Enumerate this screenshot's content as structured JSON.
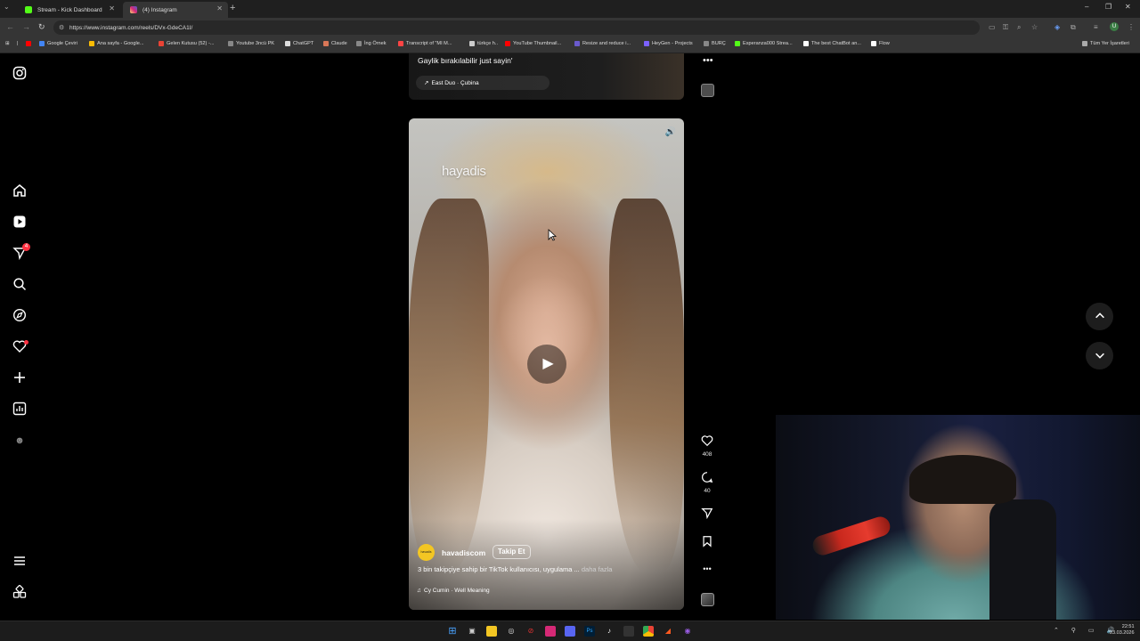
{
  "browser": {
    "tabs": [
      {
        "title": "Stream - Kick Dashboard",
        "color": "#53fc18"
      },
      {
        "title": "(4) Instagram",
        "color": "#e1306c"
      }
    ],
    "url": "https://www.instagram.com/reels/DVx-GdeCA1I/",
    "bookmarks": [
      {
        "label": "Google Çeviri",
        "color": "#4285f4"
      },
      {
        "label": "Ana sayfa - Google...",
        "color": "#fbbc05"
      },
      {
        "label": "Gelen Kutusu (52) -...",
        "color": "#ea4335"
      },
      {
        "label": "Youtube 3ncü PK",
        "color": "#888888"
      },
      {
        "label": "ChatGPT",
        "color": "#dddddd"
      },
      {
        "label": "Claude",
        "color": "#d97757"
      },
      {
        "label": "İng Örnek",
        "color": "#888888"
      },
      {
        "label": "Transcript of \"MI M...",
        "color": "#ff4444"
      },
      {
        "label": "türkçe h..",
        "color": "#cccccc"
      },
      {
        "label": "YouTube Thumbnail...",
        "color": "#ff0000"
      },
      {
        "label": "Resize and reduce i...",
        "color": "#6a5acd"
      },
      {
        "label": "HeyGen - Projects",
        "color": "#7b61ff"
      },
      {
        "label": "BURÇ",
        "color": "#888888"
      },
      {
        "label": "Esperanza000 Strea...",
        "color": "#53fc18"
      },
      {
        "label": "The best ChatBot an...",
        "color": "#ffffff"
      },
      {
        "label": "Flow",
        "color": "#ffffff"
      }
    ],
    "all_bookmarks": "Tüm Yer İşaretleri",
    "profile_initial": "U"
  },
  "sidebar": {
    "icons": [
      "instagram-logo-icon",
      "home-icon",
      "reels-icon",
      "messages-icon",
      "search-icon",
      "explore-icon",
      "notifications-icon",
      "create-icon",
      "dashboard-icon",
      "profile-icon",
      "more-menu-icon",
      "also-from-meta-icon"
    ],
    "message_badge": "4"
  },
  "previous_reel": {
    "caption": "Gaylik bırakılabilir just sayin'",
    "audio": "East Duo · Çubina"
  },
  "reel": {
    "watermark": "hayadis",
    "author": "havadiscom",
    "avatar_text": "havadis",
    "follow_label": "Takip Et",
    "caption": "3 bin takipçiye sahip bir TikTok kullanıcısı, uygulama ...",
    "caption_more": "daha fazla",
    "audio": "Cy Cumin · Well Meaning",
    "likes": "408",
    "comments": "40"
  },
  "taskbar": {
    "time": "22:51",
    "date": "23.03.2026"
  },
  "colors": {
    "background": "#000000",
    "accent_red": "#ff3040",
    "avatar_yellow": "#f3c623"
  }
}
